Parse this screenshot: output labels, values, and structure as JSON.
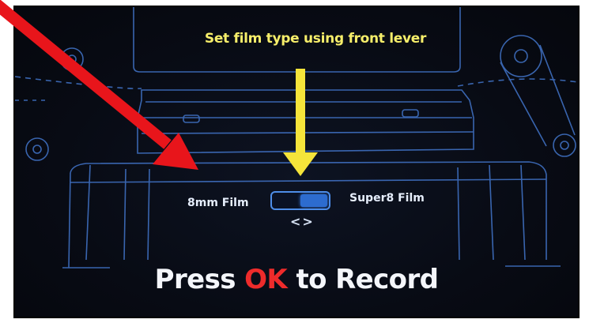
{
  "screen": {
    "instruction": "Set film type using front lever",
    "film_options": {
      "left_label": "8mm Film",
      "right_label": "Super8 Film",
      "selected": "Super8 Film",
      "switch_glyph": "<>"
    },
    "record_prompt": {
      "prefix": "Press",
      "key": "OK",
      "suffix": "to Record"
    }
  },
  "colors": {
    "background": "#080b14",
    "line_art": "#3f6fc0",
    "instruction_text": "#f6ee6a",
    "pointer_arrow": "#f5e43a",
    "ok_highlight": "#ee2b2b",
    "toggle_accent": "#2d6ccf",
    "annotation_arrow": "#e8151b"
  },
  "icons": {
    "down_arrow": "arrow-down-icon",
    "annotation": "annotation-arrow-icon",
    "switch": "chevrons-left-right-icon"
  }
}
